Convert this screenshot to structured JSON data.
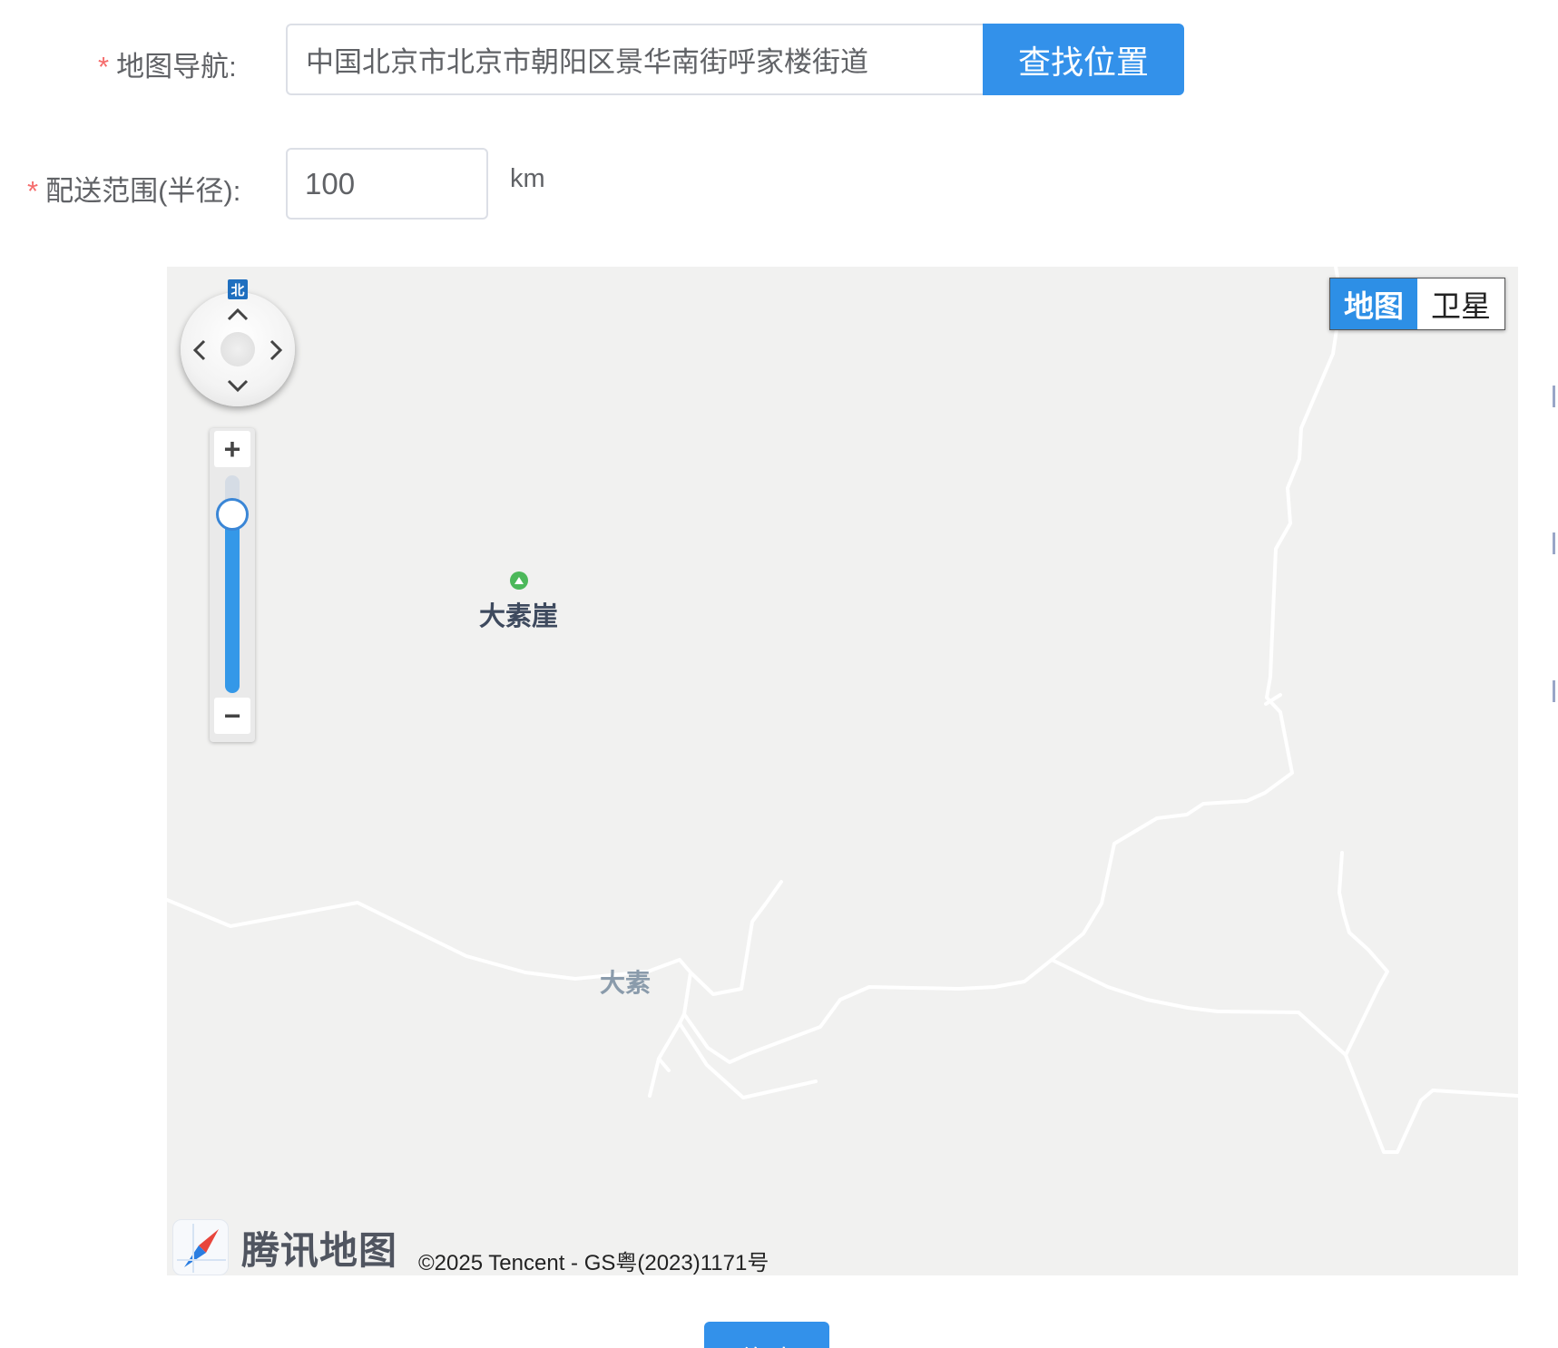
{
  "form": {
    "address_label": "地图导航:",
    "address_value": "中国北京市北京市朝阳区景华南街呼家楼街道",
    "search_button": "查找位置",
    "radius_label": "配送范围(半径):",
    "radius_value": "100",
    "radius_unit": "km",
    "required_mark": "*"
  },
  "map": {
    "north_label": "北",
    "zoom_in": "+",
    "zoom_out": "−",
    "zoom_level_fraction": 0.82,
    "type_toggle": {
      "map": "地图",
      "satellite": "卫星",
      "selected": "map"
    },
    "poi_name": "大素崖",
    "place_name": "大素",
    "brand": "腾讯地图",
    "copyright": "©2025 Tencent - GS粤(2023)1171号",
    "colors": {
      "background": "#f1f1f0",
      "road": "#ffffff",
      "accent": "#3391ea",
      "poi": "#4cb85a"
    }
  },
  "actions": {
    "submit_button": "修改"
  }
}
